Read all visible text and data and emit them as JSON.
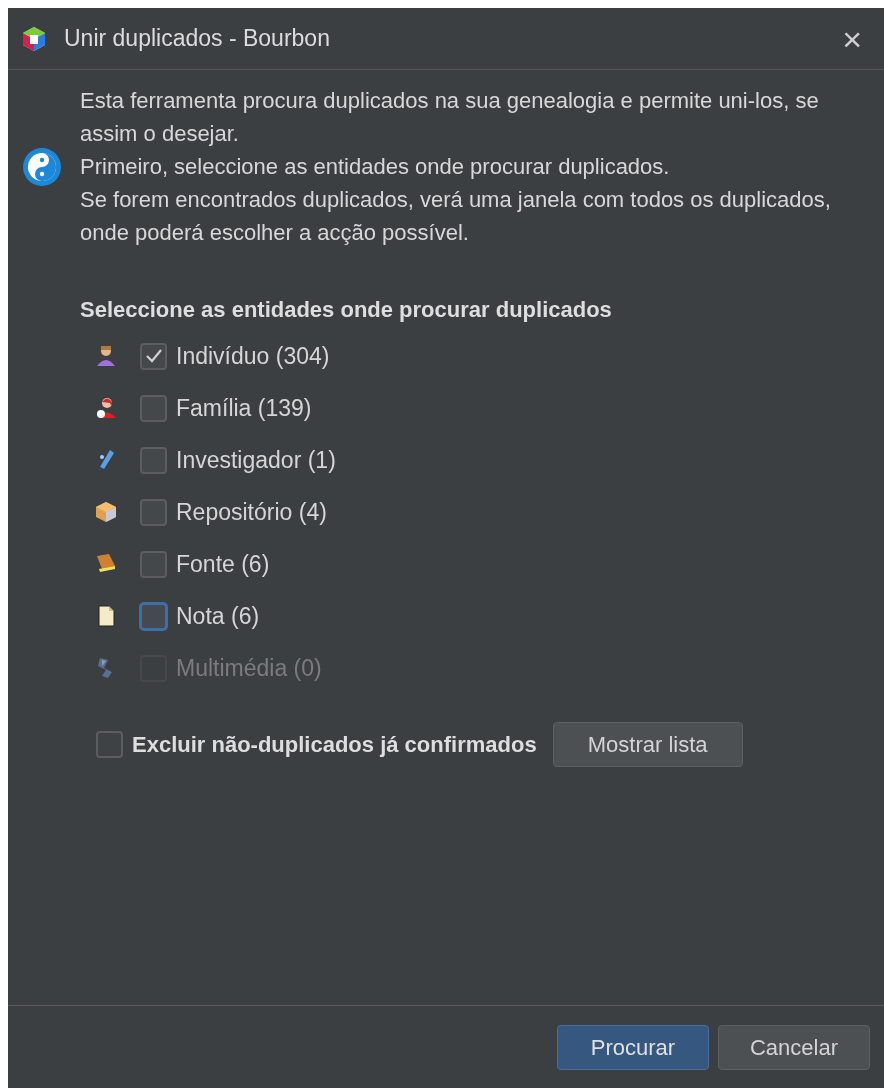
{
  "window": {
    "title": "Unir duplicados - Bourbon",
    "close": "×"
  },
  "intro": [
    "Esta ferramenta procura duplicados na sua genealogia e permite uni-los, se assim o desejar.",
    "Primeiro, seleccione as entidades onde procurar duplicados.",
    "Se forem encontrados duplicados, verá uma janela com todos os duplicados, onde poderá escolher a acção possível."
  ],
  "section_title": "Seleccione as entidades onde procurar duplicados",
  "entities": [
    {
      "kind": "individual",
      "label": "Indivíduo (304)",
      "checked": true,
      "focused": false,
      "disabled": false
    },
    {
      "kind": "family",
      "label": "Família (139)",
      "checked": false,
      "focused": false,
      "disabled": false
    },
    {
      "kind": "researcher",
      "label": "Investigador (1)",
      "checked": false,
      "focused": false,
      "disabled": false
    },
    {
      "kind": "repository",
      "label": "Repositório (4)",
      "checked": false,
      "focused": false,
      "disabled": false
    },
    {
      "kind": "source",
      "label": "Fonte (6)",
      "checked": false,
      "focused": false,
      "disabled": false
    },
    {
      "kind": "note",
      "label": "Nota (6)",
      "checked": false,
      "focused": true,
      "disabled": false
    },
    {
      "kind": "media",
      "label": "Multimédia (0)",
      "checked": false,
      "focused": false,
      "disabled": true
    }
  ],
  "exclude": {
    "label": "Excluir não-duplicados já confirmados",
    "checked": false
  },
  "show_list_button": "Mostrar lista",
  "buttons": [
    {
      "label": "Procurar",
      "default": true
    },
    {
      "label": "Cancelar",
      "default": false
    }
  ]
}
